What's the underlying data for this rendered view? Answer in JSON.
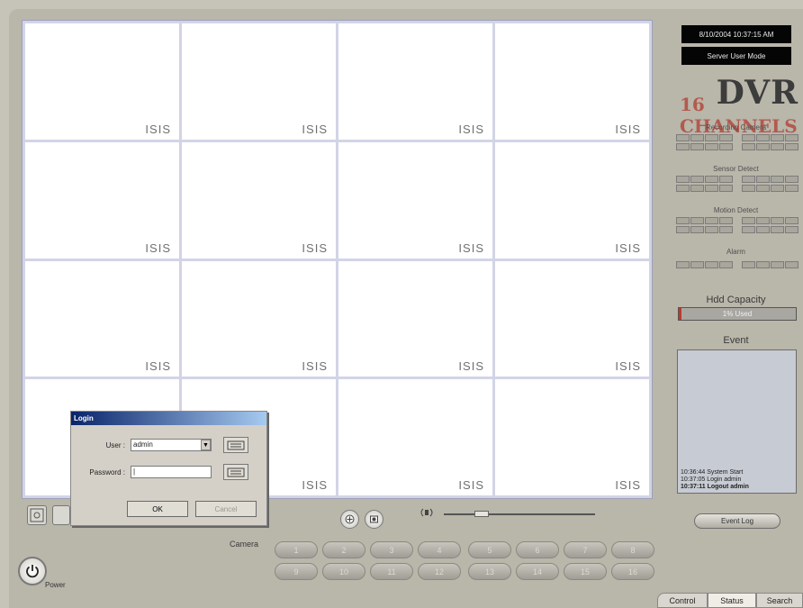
{
  "status": {
    "datetime": "8/10/2004 10:37:15 AM",
    "mode": "Server User Mode"
  },
  "logo": {
    "title": "DVR",
    "subtitle": "16 CHANNELS"
  },
  "grid": {
    "watermark": "ISIS"
  },
  "indicators": {
    "recording_label": "Recording Camera",
    "sensor_label": "Sensor Detect",
    "motion_label": "Motion Detect",
    "alarm_label": "Alarm"
  },
  "hdd": {
    "label": "Hdd Capacity",
    "text": "1% Used",
    "used_fraction": 0.01
  },
  "event": {
    "label": "Event",
    "entries": [
      "10:36:44 System Start",
      "10:37:05 Login admin",
      "10:37:11 Logout admin"
    ],
    "log_button": "Event Log"
  },
  "camera": {
    "label": "Camera",
    "buttons": [
      "1",
      "2",
      "3",
      "4",
      "5",
      "6",
      "7",
      "8",
      "9",
      "10",
      "11",
      "12",
      "13",
      "14",
      "15",
      "16"
    ]
  },
  "volume": {
    "level": 0.25
  },
  "power": {
    "label": "Power"
  },
  "tabs": {
    "control": "Control",
    "status": "Status",
    "search": "Search"
  },
  "login": {
    "title": "Login",
    "user_label": "User :",
    "user_value": "admin",
    "password_label": "Password :",
    "password_value": "|",
    "ok_label": "OK",
    "cancel_label": "Cancel"
  },
  "icons": {
    "power": "power-icon",
    "zoom": "zoom-icon",
    "record": "record-icon",
    "speaker": "speaker-icon",
    "keyboard": "keyboard-icon"
  }
}
